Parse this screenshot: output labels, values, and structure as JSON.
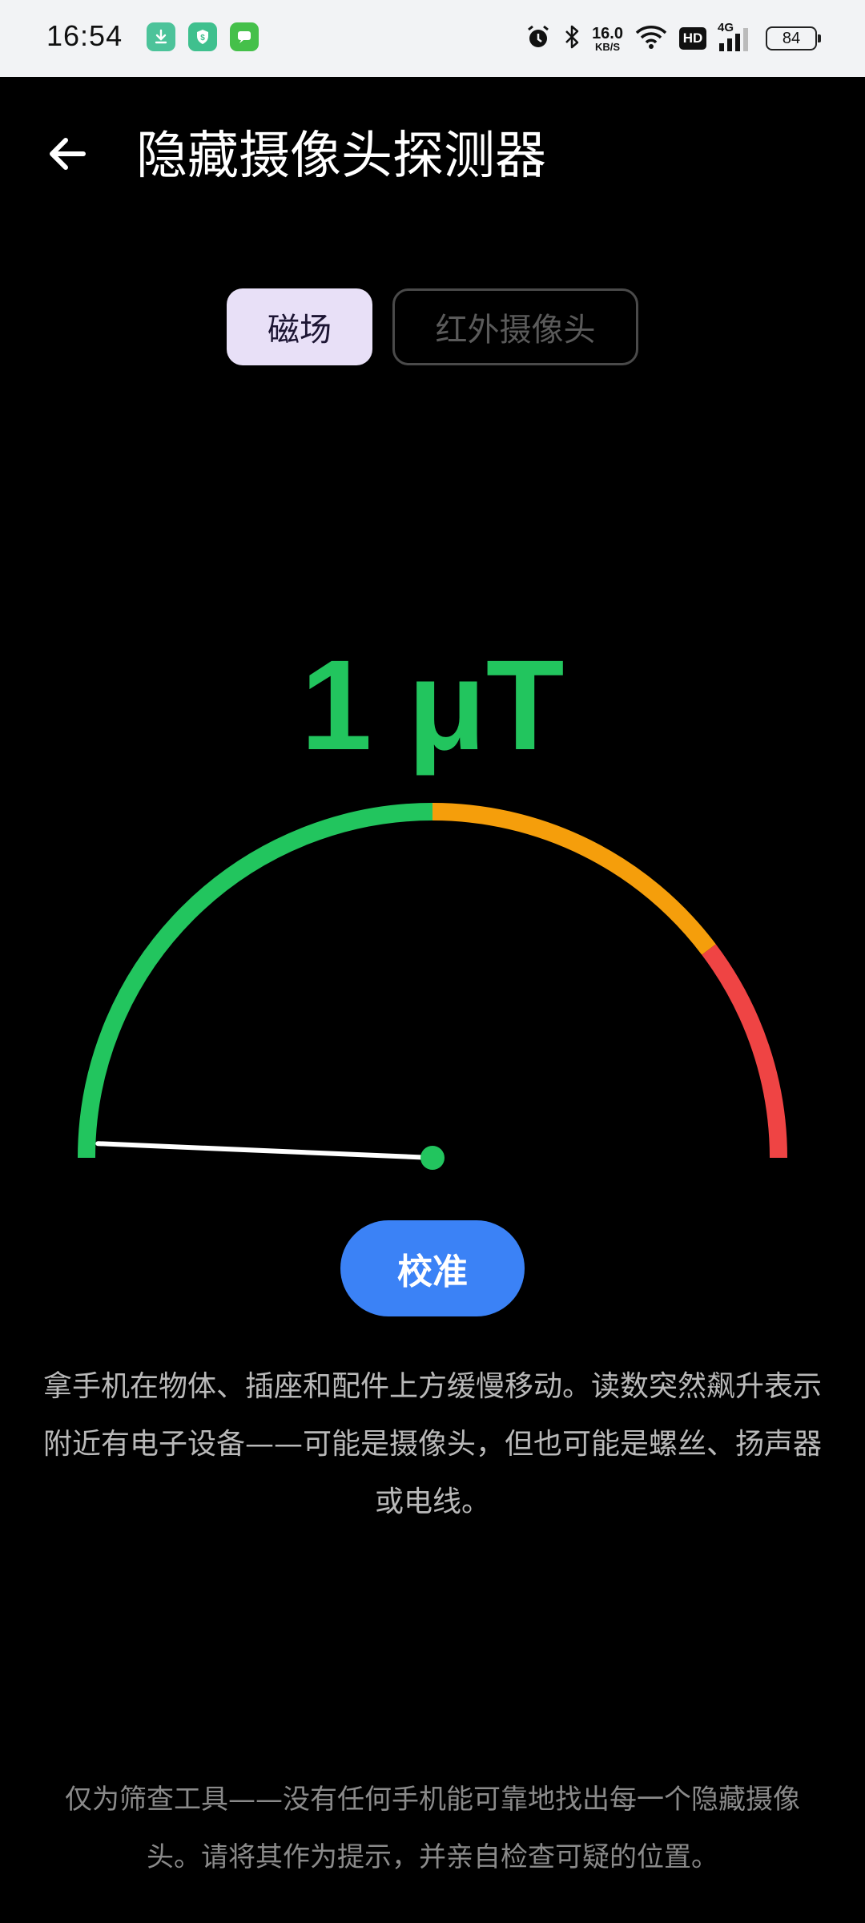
{
  "status_bar": {
    "time": "16:54",
    "net_speed_value": "16.0",
    "net_speed_unit": "KB/S",
    "hd_label": "HD",
    "network_type": "4G",
    "battery_level": "84",
    "notification_icons": [
      "download-icon",
      "security-shield-icon",
      "messages-icon"
    ]
  },
  "app_bar": {
    "back_icon": "arrow-left-icon",
    "title": "隐藏摄像头探测器"
  },
  "tabs": [
    {
      "label": "磁场",
      "selected": true
    },
    {
      "label": "红外摄像头",
      "selected": false
    }
  ],
  "meter": {
    "value": "1",
    "unit": "μT",
    "display": "1 μT",
    "gauge_zones": [
      {
        "name": "low",
        "color": "#22c55e"
      },
      {
        "name": "medium",
        "color": "#f59e0b"
      },
      {
        "name": "high",
        "color": "#ef4444"
      }
    ],
    "needle_level_fraction": 0.012
  },
  "calibrate_button": "校准",
  "instructions": "拿手机在物体、插座和配件上方缓慢移动。读数突然飙升表示附近有电子设备——可能是摄像头，但也可能是螺丝、扬声器或电线。",
  "disclaimer": "仅为筛查工具——没有任何手机能可靠地找出每一个隐藏摄像头。请将其作为提示，并亲自检查可疑的位置。"
}
